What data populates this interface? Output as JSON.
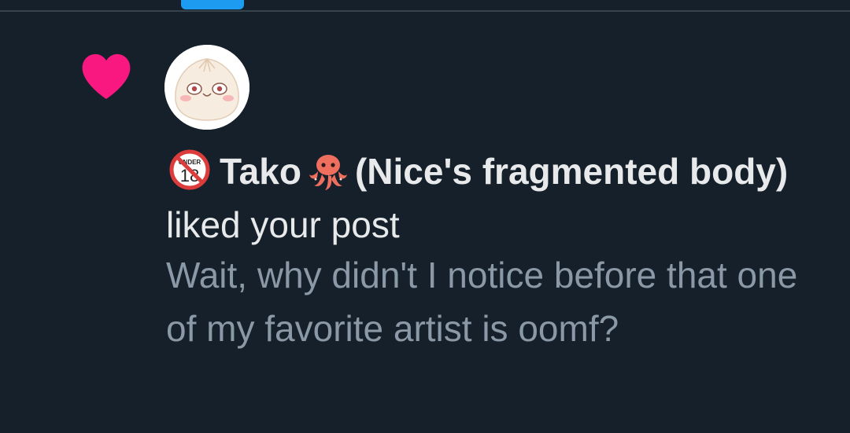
{
  "notification": {
    "badge_icon": "no-under-18-icon",
    "badge_text": "UNDER",
    "badge_number": "18",
    "name_part1": "Tako",
    "name_emoji": "octopus-icon",
    "name_part2": "(Nice's fragmented body)",
    "action": "liked your post",
    "like_icon": "heart-icon",
    "like_color": "#f91880",
    "post_text": "Wait, why didn't I notice before that one of my favorite artist is oomf?"
  },
  "colors": {
    "background": "#15202b",
    "accent": "#1d9bf0",
    "primary_text": "#e7e9ea",
    "secondary_text": "#8b98a5"
  }
}
